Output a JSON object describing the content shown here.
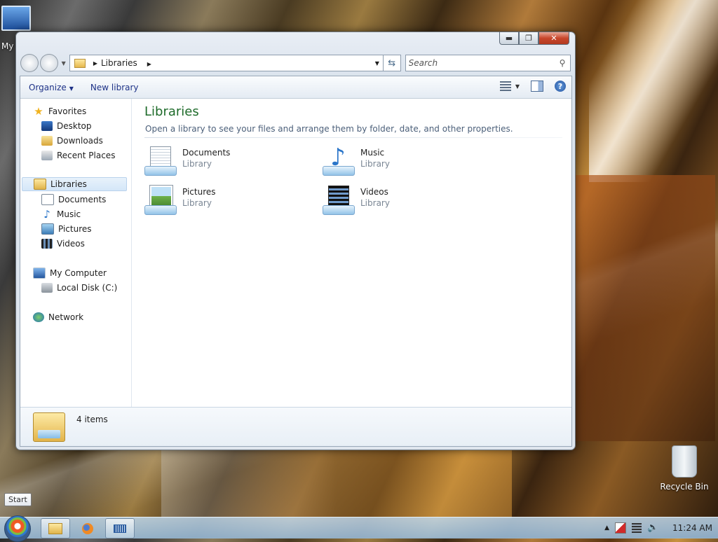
{
  "desktop": {
    "my_computer_label": "My",
    "recycle_bin_label": "Recycle Bin"
  },
  "window": {
    "caption_buttons": {
      "minimize": "▬",
      "maximize": "❐",
      "close": "✕"
    },
    "address": {
      "crumb": "Libraries",
      "search_placeholder": "Search"
    },
    "toolbar": {
      "organize": "Organize",
      "new_library": "New library"
    },
    "nav": {
      "favorites": "Favorites",
      "desktop": "Desktop",
      "downloads": "Downloads",
      "recent_places": "Recent Places",
      "libraries": "Libraries",
      "documents": "Documents",
      "music": "Music",
      "pictures": "Pictures",
      "videos": "Videos",
      "my_computer": "My Computer",
      "local_disk": "Local Disk (C:)",
      "network": "Network"
    },
    "main": {
      "title": "Libraries",
      "subtitle": "Open a library to see your files and arrange them by folder, date, and other properties.",
      "items": [
        {
          "name": "Documents",
          "type": "Library"
        },
        {
          "name": "Music",
          "type": "Library"
        },
        {
          "name": "Pictures",
          "type": "Library"
        },
        {
          "name": "Videos",
          "type": "Library"
        }
      ]
    },
    "details": {
      "count": "4 items"
    }
  },
  "taskbar": {
    "start_tooltip": "Start",
    "clock": "11:24 AM"
  },
  "icons": [
    "search-icon",
    "refresh-icon",
    "help-icon",
    "views-icon",
    "preview-pane-icon",
    "star-icon",
    "folder-icon",
    "music-note-icon",
    "film-icon",
    "computer-icon",
    "disk-icon",
    "network-icon",
    "recycle-bin-icon",
    "firefox-icon",
    "keyboard-icon",
    "speaker-icon",
    "flag-icon"
  ]
}
